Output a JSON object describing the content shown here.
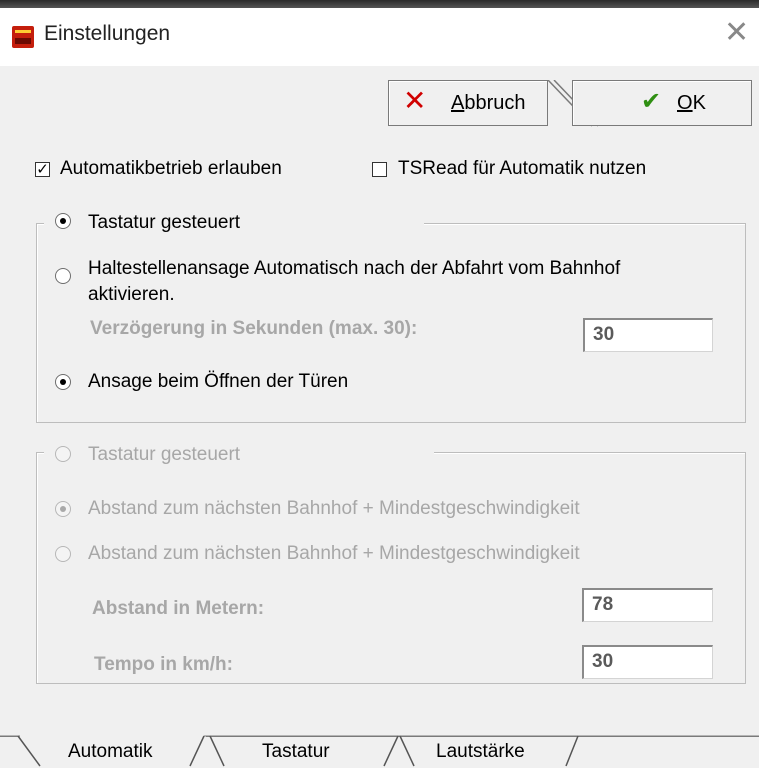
{
  "window": {
    "title": "Einstellungen",
    "close_glyph": "✕"
  },
  "buttons": {
    "cancel_label": "Abbruch",
    "cancel_icon": "cross-icon",
    "ok_label": "OK",
    "ok_icon": "checkmark-icon"
  },
  "options": {
    "auto_allow": {
      "label": "Automatikbetrieb erlauben",
      "checked": true
    },
    "tsread": {
      "label": "TSRead für Automatik nutzen",
      "checked": false
    }
  },
  "group1": {
    "legend": "Tastatur gesteuert",
    "radio_auto_label_line1": "Haltestellenansage Automatisch nach der Abfahrt vom Bahnhof",
    "radio_auto_label_line2": "aktivieren.",
    "delay_label": "Verzögerung in Sekunden (max. 30):",
    "delay_value": "30",
    "radio_doors_label": "Ansage beim Öffnen der Türen"
  },
  "group2": {
    "legend": "Tastatur gesteuert",
    "radio1_label": "Abstand zum nächsten Bahnhof + Mindestgeschwindigkeit",
    "radio2_label": "Abstand zum nächsten Bahnhof + Mindestgeschwindigkeit",
    "distance_label": "Abstand in Metern:",
    "distance_value": "78",
    "speed_label": "Tempo in km/h:",
    "speed_value": "30"
  },
  "tabs": [
    {
      "label": "Automatik",
      "active": true
    },
    {
      "label": "Tastatur",
      "active": false
    },
    {
      "label": "Lautstärke",
      "active": false
    }
  ],
  "colors": {
    "cancel_icon": "#d00000",
    "ok_icon": "#2f8f12",
    "app_icon": "#c41e0c"
  }
}
